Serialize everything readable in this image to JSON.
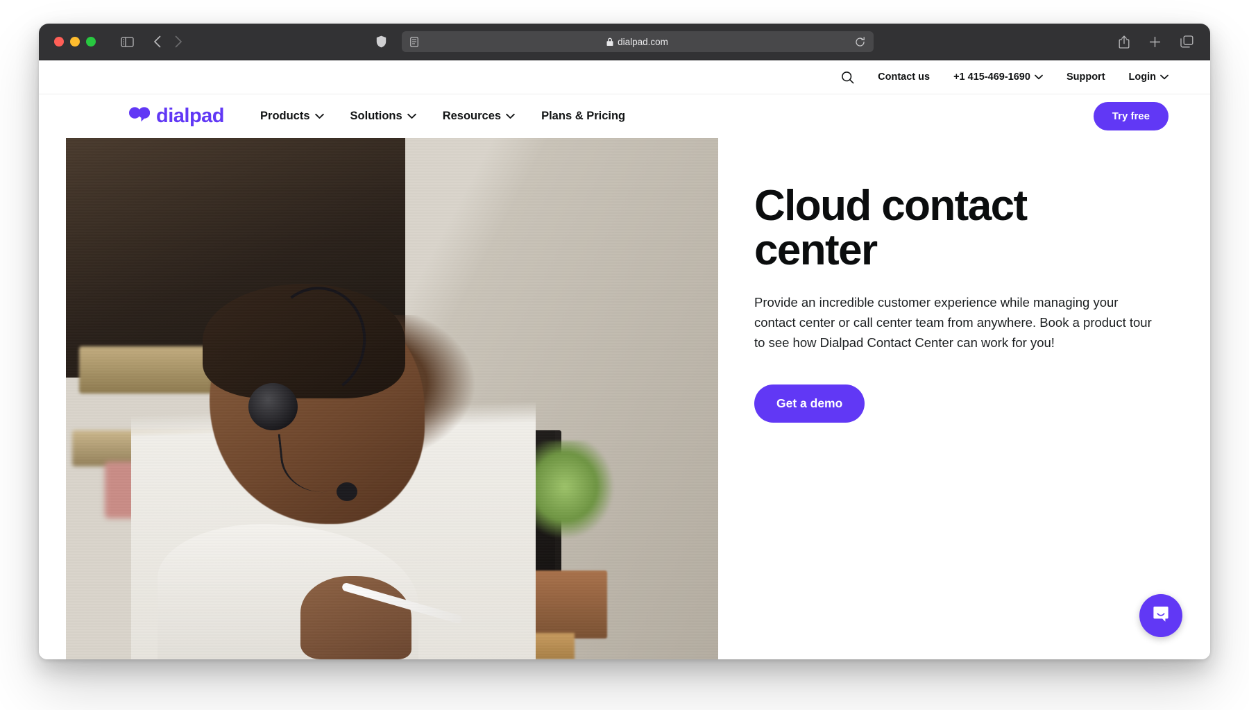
{
  "browser": {
    "url": "dialpad.com",
    "lock_icon": "lock-icon",
    "shield_icon": "shield-icon",
    "reader_icon": "reader-view-icon",
    "reload_icon": "reload-icon",
    "sidebar_icon": "sidebar-toggle-icon",
    "back_icon": "back-arrow-icon",
    "forward_icon": "forward-arrow-icon",
    "share_icon": "share-icon",
    "new_tab_icon": "plus-icon",
    "tab_overview_icon": "tab-overview-icon",
    "traffic_lights": [
      "close-button",
      "minimize-button",
      "maximize-button"
    ]
  },
  "utility_bar": {
    "search_icon": "search-icon",
    "items": [
      {
        "label": "Contact us",
        "chevron": false
      },
      {
        "label": "+1 415-469-1690",
        "chevron": true
      },
      {
        "label": "Support",
        "chevron": false
      },
      {
        "label": "Login",
        "chevron": true
      }
    ]
  },
  "nav": {
    "logo_text": "dialpad",
    "logo_icon": "dialpad-logo-icon",
    "links": [
      {
        "label": "Products",
        "chevron": true
      },
      {
        "label": "Solutions",
        "chevron": true
      },
      {
        "label": "Resources",
        "chevron": true
      },
      {
        "label": "Plans & Pricing",
        "chevron": false
      }
    ],
    "try_free_label": "Try free"
  },
  "hero": {
    "title": "Cloud contact center",
    "description": "Provide an incredible customer experience while managing your contact center or call center team from anywhere. Book a product tour to see how Dialpad Contact Center can work for you!",
    "cta_label": "Get a demo",
    "image_alt": "man-with-headset-at-desk-photo"
  },
  "chat": {
    "icon": "chat-bubble-icon"
  },
  "colors": {
    "brand_purple": "#6138f5",
    "text_dark": "#0b0d0e",
    "chrome_dark": "#323234",
    "url_field": "#48484a"
  }
}
